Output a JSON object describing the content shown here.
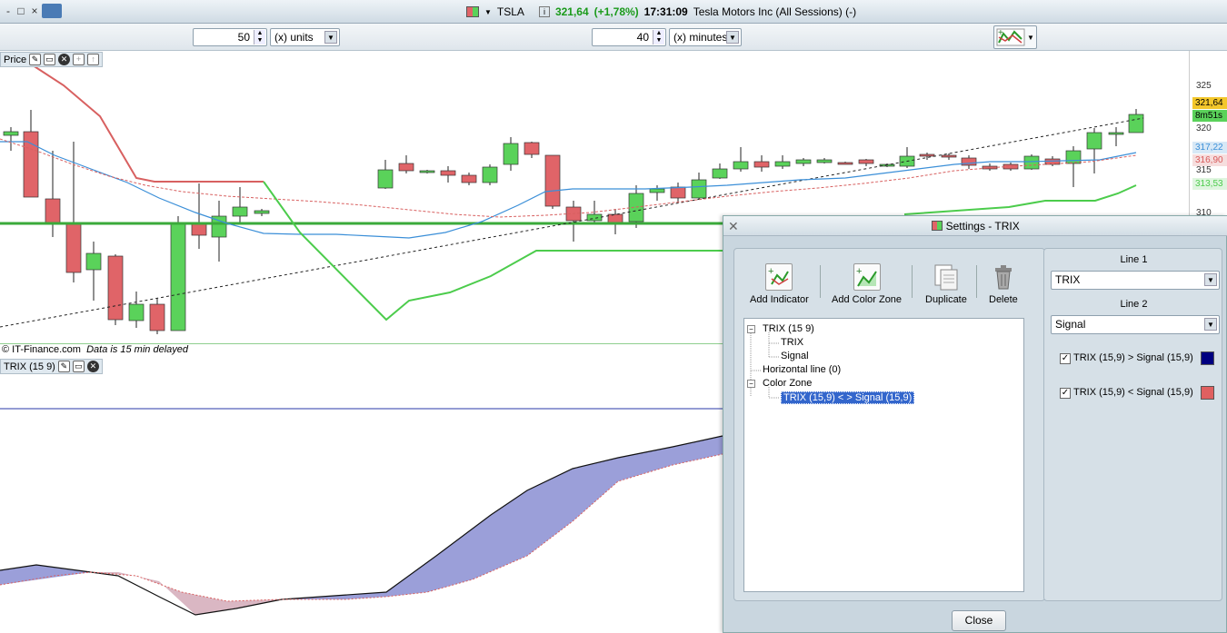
{
  "window": {
    "buttons": [
      "-",
      "□",
      "×"
    ]
  },
  "title": {
    "symbol": "TSLA",
    "price": "321,64",
    "change": "(+1,78%)",
    "time": "17:31:09",
    "name": "Tesla Motors Inc (All Sessions) (-)"
  },
  "toolbar": {
    "units_value": "50",
    "units_label": "(x) units",
    "minutes_value": "40",
    "minutes_label": "(x) minutes"
  },
  "price_panel": {
    "tag": "Price",
    "credit": "© IT-Finance.com",
    "delayed": "Data is 15 min delayed",
    "axis_ticks": [
      "325",
      "320",
      "315",
      "310"
    ],
    "labels": {
      "last": "321,64",
      "countdown": "8m51s",
      "blue": "317,22",
      "red": "316,90",
      "green": "313,53"
    }
  },
  "trix_panel": {
    "tag": "TRIX (15 9)"
  },
  "dialog": {
    "title": "Settings - TRIX",
    "buttons": {
      "add_indicator": "Add Indicator",
      "add_color_zone": "Add Color Zone",
      "duplicate": "Duplicate",
      "delete": "Delete"
    },
    "tree": {
      "root": "TRIX (15 9)",
      "child1": "TRIX",
      "child2": "Signal",
      "hline": "Horizontal line (0)",
      "zone": "Color Zone",
      "zone_item": "TRIX (15,9) < > Signal (15,9)"
    },
    "line1_label": "Line 1",
    "line1_value": "TRIX",
    "line2_label": "Line 2",
    "line2_value": "Signal",
    "cond1": "TRIX (15,9) > Signal (15,9)",
    "cond2": "TRIX (15,9) < Signal (15,9)",
    "cond1_color": "#000080",
    "cond2_color": "#e06060",
    "close": "Close"
  },
  "colors": {
    "up": "#5ad25a",
    "down": "#e06468",
    "blue": "#3b8fd8",
    "green": "#4ccc4c",
    "red_ma": "#d85a5a",
    "trix_fill": "#9b9fd9",
    "signal_fill": "#dab7c3"
  }
}
